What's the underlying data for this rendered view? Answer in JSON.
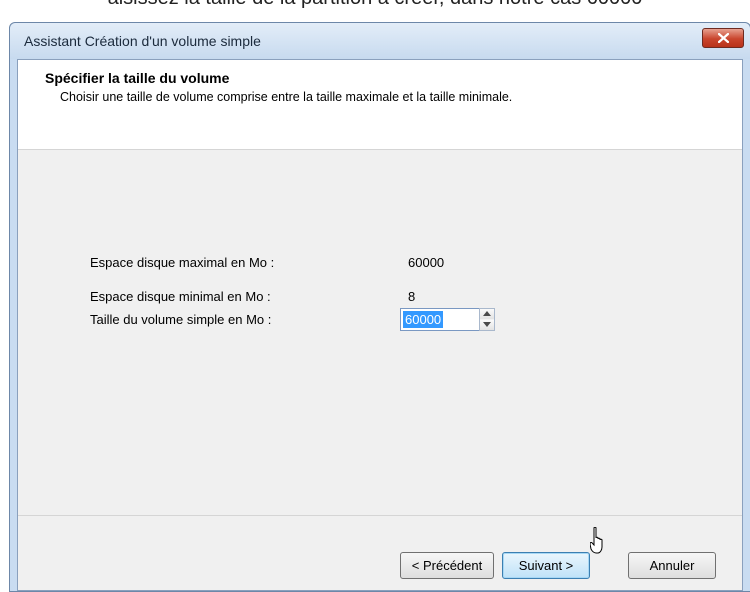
{
  "caption": "aisissez la taille de la partition à créer, dans notre cas 60000",
  "window": {
    "title": "Assistant Création d'un volume simple"
  },
  "header": {
    "title": "Spécifier la taille du volume",
    "subtitle": "Choisir une taille de volume comprise entre la taille maximale et la taille minimale."
  },
  "fields": {
    "max_label": "Espace disque maximal en Mo :",
    "max_value": "60000",
    "min_label": "Espace disque minimal en Mo :",
    "min_value": "8",
    "size_label": "Taille du volume simple en Mo :",
    "size_value": "60000"
  },
  "buttons": {
    "back": "< Précédent",
    "next": "Suivant >",
    "cancel": "Annuler"
  },
  "icons": {
    "close": "close-icon",
    "spin_up": "spin-up-icon",
    "spin_down": "spin-down-icon",
    "cursor": "mouse-pointer-icon"
  },
  "colors": {
    "close_button": "#c9452d",
    "selection": "#3399ff",
    "frame": "#c9dcf1"
  }
}
